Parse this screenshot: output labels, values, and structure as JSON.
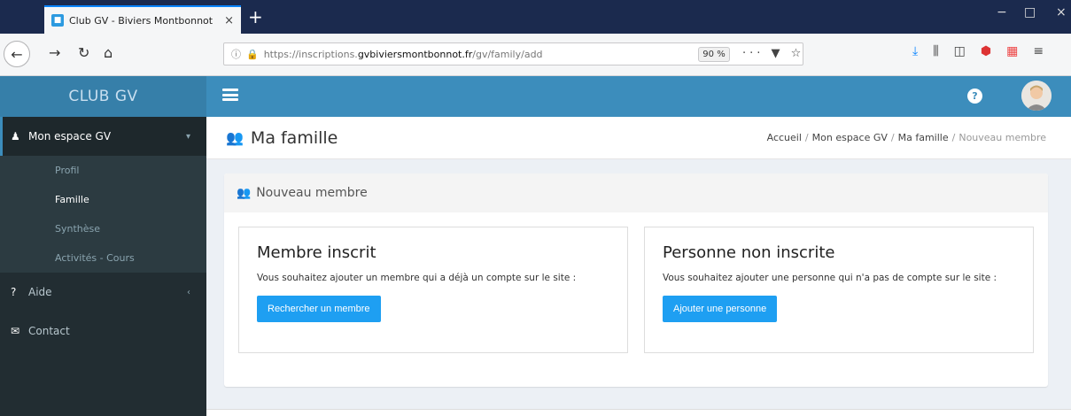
{
  "browser": {
    "tab_title": "Club GV - Biviers Montbonnot",
    "tab_close": "×",
    "new_tab": "+",
    "url_prefix": "https://inscriptions.",
    "url_domain": "gvbiviersmontbonnot.fr",
    "url_path": "/gv/family/add",
    "zoom": "90 %",
    "url_actions": "··· ▼ ☆",
    "window_controls": {
      "minimize": "−",
      "maximize": "□",
      "close": "×"
    }
  },
  "sidebar": {
    "brand": "CLUB GV",
    "items": [
      {
        "label": "Mon espace GV",
        "icon": "user-icon",
        "glyph": "♟"
      },
      {
        "label": "Aide",
        "icon": "help-icon",
        "glyph": "?"
      },
      {
        "label": "Contact",
        "icon": "envelope-icon",
        "glyph": "✉"
      }
    ],
    "submenu": [
      "Profil",
      "Famille",
      "Synthèse",
      "Activités - Cours"
    ],
    "caret_down": "▾",
    "caret_right": "‹"
  },
  "topnav": {
    "help": "?"
  },
  "header": {
    "title": "Ma famille",
    "breadcrumb": [
      "Accueil",
      "Mon espace GV",
      "Ma famille",
      "Nouveau membre"
    ],
    "separator": "/"
  },
  "box": {
    "title": "Nouveau membre",
    "cards": [
      {
        "title": "Membre inscrit",
        "text": "Vous souhaitez ajouter un membre qui a déjà un compte sur le site :",
        "button": "Rechercher un membre"
      },
      {
        "title": "Personne non inscrite",
        "text": "Vous souhaitez ajouter une personne qui n'a pas de compte sur le site :",
        "button": "Ajouter une personne"
      }
    ]
  },
  "colors": {
    "primary": "#3c8dbc",
    "brand_bg": "#367fa9",
    "sidebar_bg": "#222d32",
    "button": "#1e9ff2",
    "content_bg": "#ecf0f5"
  }
}
